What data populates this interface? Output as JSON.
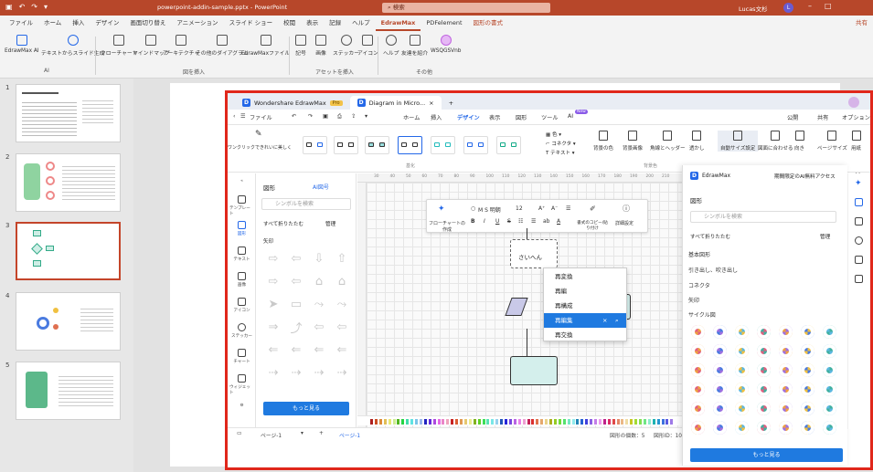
{
  "ppt": {
    "title": "powerpoint-addin-sample.pptx  -  PowerPoint",
    "search_placeholder": "検索",
    "user_name": "Lucas文杉",
    "user_initial": "L",
    "menu_tabs": [
      "ファイル",
      "ホーム",
      "挿入",
      "デザイン",
      "画面切り替え",
      "アニメーション",
      "スライド ショー",
      "校閲",
      "表示",
      "記録",
      "ヘルプ",
      "EdrawMax",
      "PDFelement",
      "図形の書式"
    ],
    "share_label": "共有",
    "ribbon": {
      "buttons": [
        "EdrawMax AI",
        "テキストからスライド生成",
        "フローチャート",
        "マインドマップ",
        "アーキテクチャ",
        "その他のダイアグラム",
        "EdrawMaxファイル",
        "記号",
        "画像",
        "ステッカー",
        "アイコン",
        "ヘルプ",
        "友達を紹介",
        "WSQGSVnb"
      ],
      "groups": [
        "AI",
        "図を挿入",
        "アセットを挿入",
        "その他"
      ]
    },
    "slide_numbers": [
      "1",
      "2",
      "3",
      "4",
      "5"
    ]
  },
  "edraw": {
    "tabs": {
      "app": "Wondershare EdrawMax",
      "pro": "Pro",
      "doc": "Diagram in Micro...",
      "new_tab": "+"
    },
    "menu": {
      "file": "ファイル",
      "items": [
        "ホーム",
        "挿入",
        "デザイン",
        "表示",
        "図形",
        "ツール",
        "AI"
      ],
      "ai_badge": "New",
      "publish": "公開",
      "share": "共有",
      "options": "オプション"
    },
    "ribbon": {
      "oneclick": "ワンクリックできれいに美しく",
      "style_group": "基化",
      "color": "色",
      "connector": "コネクタ",
      "text": "テキスト",
      "bg_group": "背景色",
      "buttons": [
        "背景の色",
        "背景画像",
        "透かし",
        "フッター",
        "境界線"
      ],
      "buttons2": [
        "自動サイズ設定",
        "図面に合わせる",
        "向き",
        "ページサイズ",
        "用紙"
      ],
      "header_footer": "角線とヘッダー",
      "auto_size": "自動サイズ設定"
    },
    "left_tools": [
      "テンプレート",
      "図形",
      "テキスト",
      "画像",
      "アイコン",
      "ステッカー",
      "チャート",
      "ウィジェット"
    ],
    "shapes_panel": {
      "title": "図形",
      "ai_button": "AI図号",
      "search_placeholder": "シンボルを検索",
      "collapse": "すべて折りたたむ",
      "manage": "管理",
      "category": "矢印",
      "more": "もっと見る"
    },
    "float_bar": {
      "flow_label": "フローチャートの作成",
      "font": "M S 明朝",
      "size": "12",
      "format_copy": "書式のコピー/貼り付け",
      "detail": "詳細設定"
    },
    "node_text": "さいへん",
    "context_menu": [
      "再変換",
      "再編",
      "再構成",
      "再編集",
      "再交換"
    ],
    "ruler_ticks": [
      "30",
      "40",
      "50",
      "60",
      "70",
      "80",
      "90",
      "100",
      "110",
      "120",
      "130",
      "140",
      "150",
      "160",
      "170",
      "180",
      "190",
      "200",
      "210"
    ],
    "status": {
      "page": "ページ-1",
      "add": "+",
      "page_tab": "ページ-1",
      "shape_count": "図形の個数：5",
      "shape_id": "図形ID：10"
    },
    "right_panel": {
      "title": "EdrawMax",
      "ai_access": "期間限定のAI無料アクセス",
      "section": "図形",
      "search_placeholder": "シンボルを検索",
      "collapse": "すべて折りたたむ",
      "manage": "管理",
      "categories": [
        "基本図形",
        "引き出し、吹き出し",
        "コネクタ",
        "矢印",
        "サイクル図"
      ],
      "more": "もっと見る"
    }
  },
  "colors": {
    "ppt_red": "#b7472a",
    "frame_red": "#e0271b",
    "accent_blue": "#1f7ae0",
    "shape_fill": "#d4efec"
  }
}
